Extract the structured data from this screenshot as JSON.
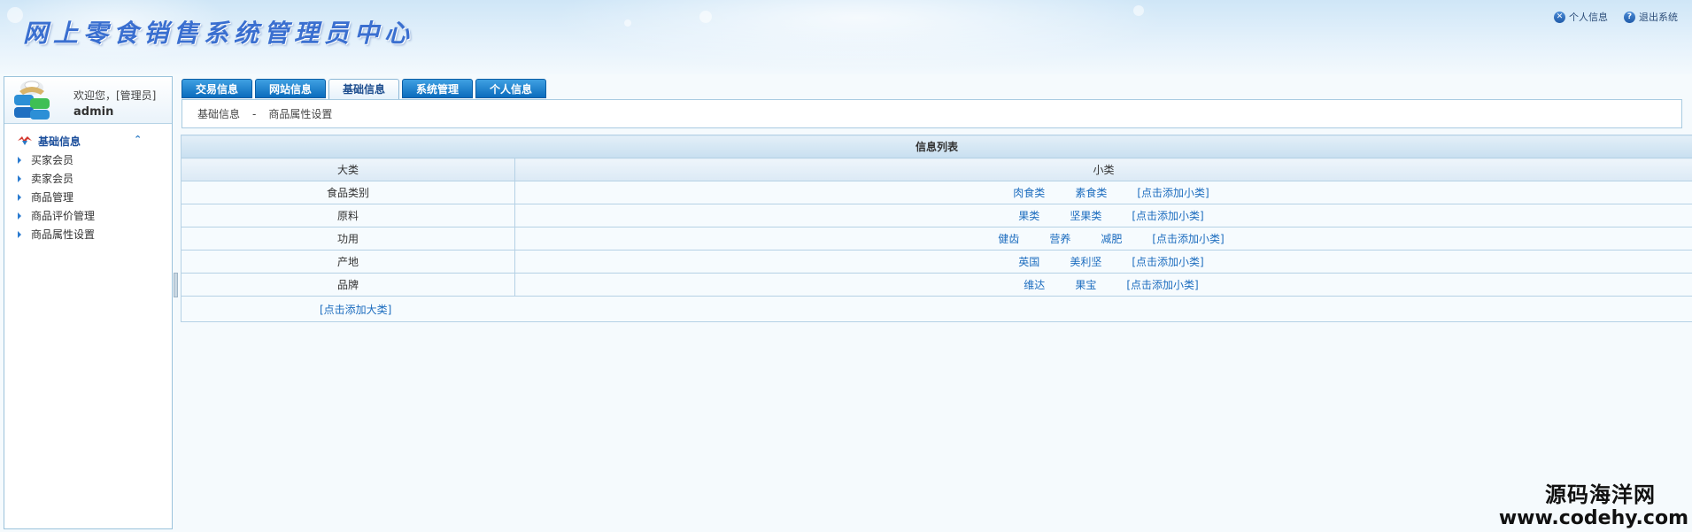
{
  "header": {
    "title": "网上零食销售系统管理员中心",
    "links": [
      {
        "label": "个人信息",
        "icon": "user-info-icon"
      },
      {
        "label": "退出系统",
        "icon": "help-exit-icon"
      }
    ]
  },
  "sidebar": {
    "welcome": "欢迎您，[管理员]",
    "username": "admin",
    "section_title": "基础信息",
    "items": [
      {
        "label": "买家会员"
      },
      {
        "label": "卖家会员"
      },
      {
        "label": "商品管理"
      },
      {
        "label": "商品评价管理"
      },
      {
        "label": "商品属性设置"
      }
    ]
  },
  "tabs": [
    {
      "label": "交易信息",
      "active": false
    },
    {
      "label": "网站信息",
      "active": false
    },
    {
      "label": "基础信息",
      "active": true
    },
    {
      "label": "系统管理",
      "active": false
    },
    {
      "label": "个人信息",
      "active": false
    }
  ],
  "breadcrumb": {
    "section": "基础信息",
    "separator": "-",
    "page": "商品属性设置"
  },
  "table": {
    "title": "信息列表",
    "columns": [
      "大类",
      "小类"
    ],
    "rows": [
      {
        "major": "食品类别",
        "minors": [
          "肉食类",
          "素食类"
        ],
        "add_label": "[点击添加小类]"
      },
      {
        "major": "原料",
        "minors": [
          "果类",
          "坚果类"
        ],
        "add_label": "[点击添加小类]"
      },
      {
        "major": "功用",
        "minors": [
          "健齿",
          "营养",
          "减肥"
        ],
        "add_label": "[点击添加小类]"
      },
      {
        "major": "产地",
        "minors": [
          "英国",
          "美利坚"
        ],
        "add_label": "[点击添加小类]"
      },
      {
        "major": "品牌",
        "minors": [
          "维达",
          "果宝"
        ],
        "add_label": "[点击添加小类]"
      }
    ],
    "add_major_label": "[点击添加大类]"
  },
  "watermark": {
    "line1": "源码海洋网",
    "line2": "www.codehy.com"
  },
  "colors": {
    "accent": "#0b6cbd",
    "link": "#1d6dbf",
    "title": "#3a6fd0",
    "border": "#b5d1e5"
  }
}
